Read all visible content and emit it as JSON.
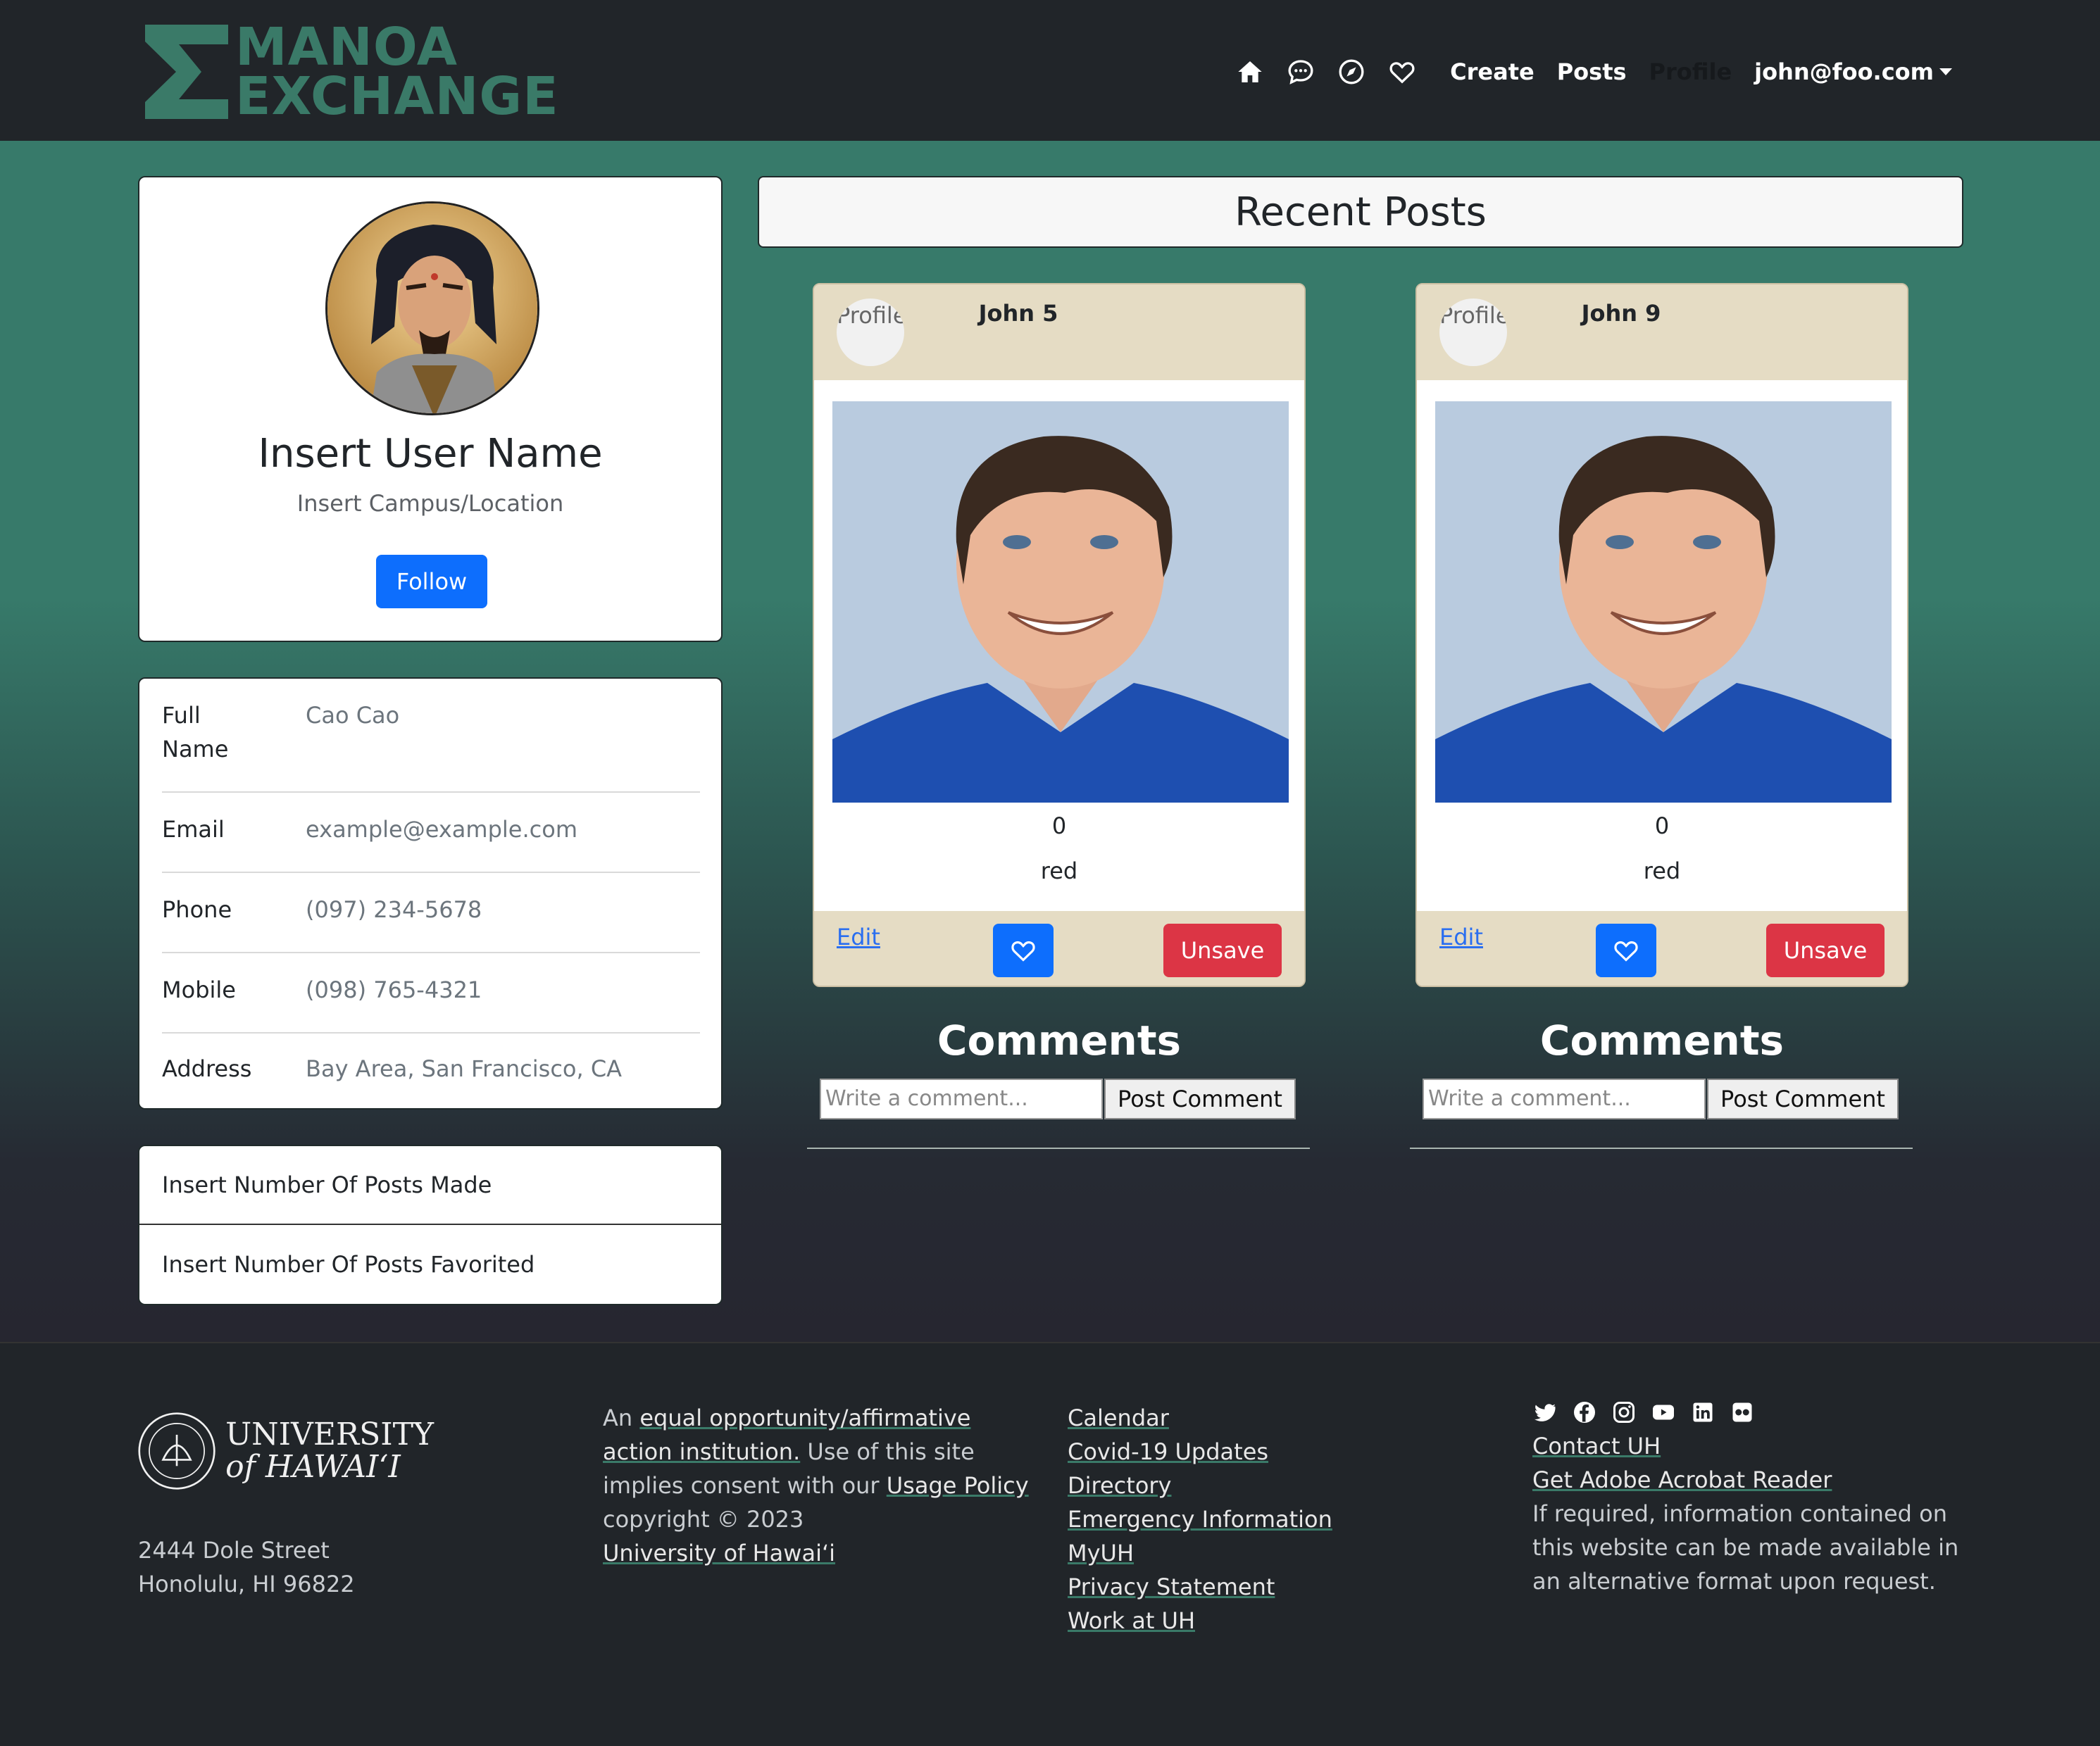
{
  "brand": {
    "line1": "MANOA",
    "line2": "EXCHANGE"
  },
  "nav": {
    "icons": [
      "home-icon",
      "chat-icon",
      "compass-icon",
      "heart-icon"
    ],
    "links": [
      "Create",
      "Posts",
      "Profile"
    ],
    "user": "john@foo.com"
  },
  "profile": {
    "name": "Insert User Name",
    "location": "Insert Campus/Location",
    "follow_label": "Follow"
  },
  "info": [
    {
      "label": "Full Name",
      "value": "Cao Cao"
    },
    {
      "label": "Email",
      "value": "example@example.com"
    },
    {
      "label": "Phone",
      "value": "(097) 234-5678"
    },
    {
      "label": "Mobile",
      "value": "(098) 765-4321"
    },
    {
      "label": "Address",
      "value": "Bay Area, San Francisco, CA"
    }
  ],
  "stats": [
    "Insert Number Of Posts Made",
    "Insert Number Of Posts Favorited"
  ],
  "recent_title": "Recent Posts",
  "posts": [
    {
      "author": "John 5",
      "avatar_alt": "Profile",
      "count": "0",
      "color": "red",
      "edit_label": "Edit",
      "unsave_label": "Unsave"
    },
    {
      "author": "John 9",
      "avatar_alt": "Profile",
      "count": "0",
      "color": "red",
      "edit_label": "Edit",
      "unsave_label": "Unsave"
    }
  ],
  "comments": {
    "title": "Comments",
    "placeholder": "Write a comment...",
    "button_label": "Post Comment"
  },
  "footer": {
    "uh_line1": "UNIVERSITY",
    "uh_line2": "of HAWAI‘I",
    "address_line1": "2444 Dole Street",
    "address_line2": "Honolulu, HI 96822",
    "eo_prefix": "An ",
    "eo_link": "equal opportunity/affirmative action institution.",
    "eo_text": " Use of this site implies consent with our ",
    "usage_link": "Usage Policy",
    "copyright": "copyright © 2023",
    "uh_link": "University of Hawaiʻi",
    "links": [
      "Calendar",
      "Covid-19 Updates",
      "Directory",
      "Emergency Information",
      "MyUH",
      "Privacy Statement",
      "Work at UH"
    ],
    "social_icons": [
      "twitter-icon",
      "facebook-icon",
      "instagram-icon",
      "youtube-icon",
      "linkedin-icon",
      "flickr-icon"
    ],
    "contact": "Contact UH",
    "acrobat": "Get Adobe Acrobat Reader",
    "accessibility": "If required, information contained on this website can be made available in an alternative format upon request."
  },
  "colors": {
    "brand": "#3a7a68",
    "primary": "#0d6efd",
    "danger": "#dc3545",
    "card_header": "#e5dcc4",
    "navbar": "#212529"
  }
}
